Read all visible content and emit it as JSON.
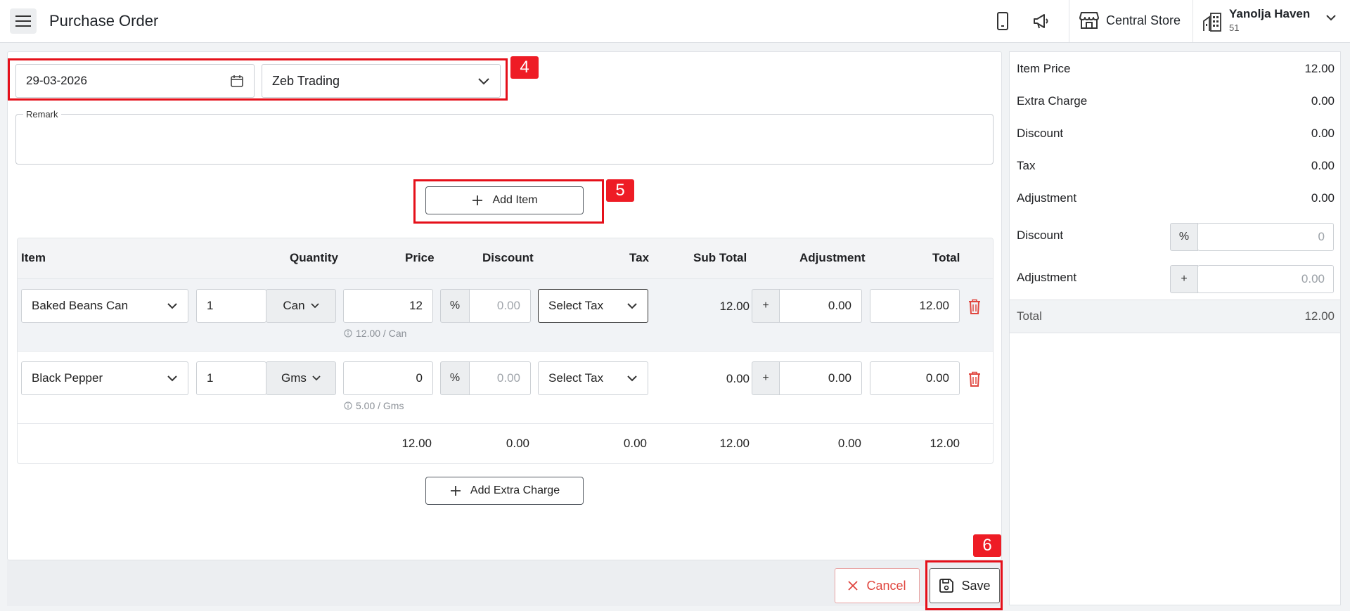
{
  "header": {
    "title": "Purchase Order",
    "store_name": "Central Store",
    "hotel_name": "Yanolja Haven",
    "hotel_id": "51"
  },
  "form": {
    "date_value": "29-03-2026",
    "vendor_value": "Zeb Trading",
    "remark_label": "Remark",
    "add_item_label": "Add Item",
    "add_extra_charge_label": "Add Extra Charge"
  },
  "table": {
    "headers": {
      "item": "Item",
      "quantity": "Quantity",
      "price": "Price",
      "discount": "Discount",
      "tax": "Tax",
      "subtotal": "Sub Total",
      "adjustment": "Adjustment",
      "total": "Total"
    },
    "rows": [
      {
        "item": "Baked Beans Can",
        "quantity": "1",
        "unit": "Can",
        "price": "12",
        "price_hint": "12.00 / Can",
        "discount_type": "%",
        "discount_placeholder": "0.00",
        "tax": "Select Tax",
        "subtotal": "12.00",
        "adjustment_sign": "+",
        "adjustment": "0.00",
        "total": "12.00"
      },
      {
        "item": "Black Pepper",
        "quantity": "1",
        "unit": "Gms",
        "price": "0",
        "price_hint": "5.00 / Gms",
        "discount_type": "%",
        "discount_placeholder": "0.00",
        "tax": "Select Tax",
        "subtotal": "0.00",
        "adjustment_sign": "+",
        "adjustment": "0.00",
        "total": "0.00"
      }
    ],
    "totals": {
      "price": "12.00",
      "discount": "0.00",
      "tax": "0.00",
      "subtotal": "12.00",
      "adjustment": "0.00",
      "total": "12.00"
    }
  },
  "summary": {
    "item_price_label": "Item Price",
    "item_price": "12.00",
    "extra_charge_label": "Extra Charge",
    "extra_charge": "0.00",
    "discount_label": "Discount",
    "discount": "0.00",
    "tax_label": "Tax",
    "tax": "0.00",
    "adjustment_label": "Adjustment",
    "adjustment": "0.00",
    "discount_input_label": "Discount",
    "discount_input_type": "%",
    "discount_input_placeholder": "0",
    "adjustment_input_label": "Adjustment",
    "adjustment_input_sign": "+",
    "adjustment_input_placeholder": "0.00",
    "total_label": "Total",
    "total": "12.00"
  },
  "footer": {
    "cancel_label": "Cancel",
    "save_label": "Save"
  },
  "annotations": [
    "4",
    "5",
    "6"
  ],
  "colors": {
    "annotation_red": "#e5101a",
    "delete_red": "#e0463f"
  }
}
